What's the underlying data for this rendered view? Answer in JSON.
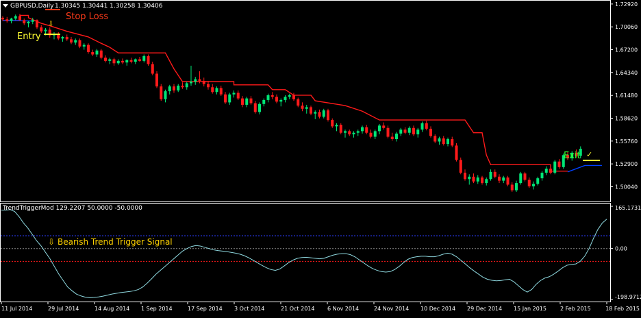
{
  "header": {
    "symbol_label": "GBPUSD,Daily",
    "ohlc": "1.30345 1.30441 1.30258 1.30406"
  },
  "indicator_header": "TrendTriggerMod 129.2207 50.0000 -50.0000",
  "annotations": {
    "stop_loss": "Stop Loss",
    "entry": "Entry",
    "exit": "Exit",
    "bearish_signal": "Bearish Trend Trigger Signal",
    "arrow_glyph": "⇩",
    "check_glyph": "✓"
  },
  "colors": {
    "background": "#000000",
    "border": "#ffffff",
    "bull": "#00e676",
    "bear": "#ff1a1a",
    "stop_line": "#ff1a1a",
    "stop_line_low": "#0040ff",
    "stop_loss_text": "#ff3b1a",
    "entry_text": "#ffff33",
    "exit_text": "#33ff33",
    "signal_text": "#ffd200",
    "oscillator": "#8fd9e0",
    "level_upper": "#2b3cff",
    "level_zero": "#888888",
    "level_lower": "#ff1a1a"
  },
  "chart_data": [
    {
      "type": "candlestick",
      "title": "GBPUSD,Daily",
      "ylim": [
        1.4888,
        1.7308
      ],
      "y_ticks": [
        "1.72920",
        "1.70060",
        "1.67200",
        "1.64340",
        "1.61480",
        "1.58620",
        "1.55760",
        "1.52900",
        "1.50040"
      ],
      "x_ticks": [
        "11 Jul 2014",
        "29 Jul 2014",
        "14 Aug 2014",
        "1 Sep 2014",
        "17 Sep 2014",
        "3 Oct 2014",
        "21 Oct 2014",
        "6 Nov 2014",
        "24 Nov 2014",
        "10 Dec 2014",
        "29 Dec 2014",
        "15 Jan 2015",
        "2 Feb 2015",
        "18 Feb 2015"
      ],
      "candles": [
        [
          1.712,
          1.714,
          1.708,
          1.71
        ],
        [
          1.71,
          1.713,
          1.706,
          1.708
        ],
        [
          1.708,
          1.712,
          1.705,
          1.711
        ],
        [
          1.711,
          1.716,
          1.709,
          1.714
        ],
        [
          1.714,
          1.717,
          1.708,
          1.709
        ],
        [
          1.709,
          1.711,
          1.703,
          1.705
        ],
        [
          1.705,
          1.708,
          1.7,
          1.707
        ],
        [
          1.707,
          1.712,
          1.704,
          1.709
        ],
        [
          1.709,
          1.71,
          1.698,
          1.7
        ],
        [
          1.7,
          1.703,
          1.693,
          1.695
        ],
        [
          1.695,
          1.699,
          1.69,
          1.697
        ],
        [
          1.697,
          1.7,
          1.687,
          1.69
        ],
        [
          1.69,
          1.694,
          1.685,
          1.692
        ],
        [
          1.692,
          1.694,
          1.684,
          1.686
        ],
        [
          1.686,
          1.689,
          1.682,
          1.688
        ],
        [
          1.688,
          1.691,
          1.683,
          1.685
        ],
        [
          1.685,
          1.688,
          1.679,
          1.681
        ],
        [
          1.681,
          1.686,
          1.678,
          1.684
        ],
        [
          1.684,
          1.686,
          1.674,
          1.676
        ],
        [
          1.676,
          1.68,
          1.672,
          1.678
        ],
        [
          1.678,
          1.68,
          1.667,
          1.669
        ],
        [
          1.669,
          1.672,
          1.664,
          1.666
        ],
        [
          1.666,
          1.673,
          1.663,
          1.671
        ],
        [
          1.671,
          1.673,
          1.66,
          1.662
        ],
        [
          1.662,
          1.665,
          1.656,
          1.658
        ],
        [
          1.658,
          1.662,
          1.654,
          1.66
        ],
        [
          1.66,
          1.662,
          1.652,
          1.655
        ],
        [
          1.655,
          1.66,
          1.653,
          1.658
        ],
        [
          1.658,
          1.661,
          1.654,
          1.656
        ],
        [
          1.656,
          1.66,
          1.652,
          1.659
        ],
        [
          1.659,
          1.662,
          1.655,
          1.657
        ],
        [
          1.657,
          1.661,
          1.654,
          1.66
        ],
        [
          1.66,
          1.663,
          1.657,
          1.658
        ],
        [
          1.658,
          1.666,
          1.656,
          1.664
        ],
        [
          1.664,
          1.666,
          1.652,
          1.654
        ],
        [
          1.654,
          1.657,
          1.64,
          1.642
        ],
        [
          1.642,
          1.645,
          1.624,
          1.626
        ],
        [
          1.626,
          1.629,
          1.608,
          1.61
        ],
        [
          1.61,
          1.622,
          1.606,
          1.62
        ],
        [
          1.62,
          1.628,
          1.616,
          1.626
        ],
        [
          1.626,
          1.629,
          1.618,
          1.621
        ],
        [
          1.621,
          1.629,
          1.619,
          1.627
        ],
        [
          1.627,
          1.631,
          1.623,
          1.625
        ],
        [
          1.625,
          1.632,
          1.622,
          1.63
        ],
        [
          1.63,
          1.652,
          1.627,
          1.632
        ],
        [
          1.632,
          1.638,
          1.628,
          1.635
        ],
        [
          1.635,
          1.645,
          1.63,
          1.633
        ],
        [
          1.633,
          1.637,
          1.626,
          1.629
        ],
        [
          1.629,
          1.633,
          1.622,
          1.625
        ],
        [
          1.625,
          1.629,
          1.617,
          1.619
        ],
        [
          1.619,
          1.626,
          1.616,
          1.624
        ],
        [
          1.624,
          1.627,
          1.614,
          1.616
        ],
        [
          1.616,
          1.619,
          1.604,
          1.606
        ],
        [
          1.606,
          1.618,
          1.603,
          1.616
        ],
        [
          1.616,
          1.621,
          1.612,
          1.618
        ],
        [
          1.618,
          1.621,
          1.609,
          1.611
        ],
        [
          1.611,
          1.614,
          1.6,
          1.603
        ],
        [
          1.603,
          1.613,
          1.6,
          1.611
        ],
        [
          1.611,
          1.614,
          1.603,
          1.605
        ],
        [
          1.605,
          1.608,
          1.592,
          1.594
        ],
        [
          1.594,
          1.606,
          1.591,
          1.604
        ],
        [
          1.604,
          1.611,
          1.601,
          1.609
        ],
        [
          1.609,
          1.617,
          1.606,
          1.615
        ],
        [
          1.615,
          1.619,
          1.61,
          1.613
        ],
        [
          1.613,
          1.616,
          1.605,
          1.607
        ],
        [
          1.607,
          1.611,
          1.601,
          1.609
        ],
        [
          1.609,
          1.615,
          1.606,
          1.613
        ],
        [
          1.613,
          1.617,
          1.61,
          1.615
        ],
        [
          1.615,
          1.618,
          1.608,
          1.61
        ],
        [
          1.61,
          1.612,
          1.6,
          1.602
        ],
        [
          1.602,
          1.606,
          1.595,
          1.598
        ],
        [
          1.598,
          1.603,
          1.592,
          1.6
        ],
        [
          1.6,
          1.602,
          1.59,
          1.592
        ],
        [
          1.592,
          1.596,
          1.585,
          1.594
        ],
        [
          1.594,
          1.597,
          1.586,
          1.588
        ],
        [
          1.588,
          1.598,
          1.586,
          1.596
        ],
        [
          1.596,
          1.598,
          1.582,
          1.584
        ],
        [
          1.584,
          1.586,
          1.574,
          1.576
        ],
        [
          1.576,
          1.58,
          1.57,
          1.578
        ],
        [
          1.578,
          1.58,
          1.566,
          1.568
        ],
        [
          1.568,
          1.572,
          1.562,
          1.57
        ],
        [
          1.57,
          1.572,
          1.564,
          1.566
        ],
        [
          1.566,
          1.57,
          1.562,
          1.568
        ],
        [
          1.568,
          1.572,
          1.564,
          1.57
        ],
        [
          1.57,
          1.577,
          1.567,
          1.575
        ],
        [
          1.575,
          1.578,
          1.566,
          1.568
        ],
        [
          1.568,
          1.572,
          1.561,
          1.563
        ],
        [
          1.563,
          1.572,
          1.56,
          1.57
        ],
        [
          1.57,
          1.579,
          1.566,
          1.577
        ],
        [
          1.577,
          1.581,
          1.572,
          1.574
        ],
        [
          1.574,
          1.577,
          1.561,
          1.563
        ],
        [
          1.563,
          1.568,
          1.558,
          1.56
        ],
        [
          1.56,
          1.569,
          1.557,
          1.567
        ],
        [
          1.567,
          1.574,
          1.564,
          1.572
        ],
        [
          1.572,
          1.575,
          1.566,
          1.568
        ],
        [
          1.568,
          1.576,
          1.565,
          1.574
        ],
        [
          1.574,
          1.577,
          1.564,
          1.566
        ],
        [
          1.566,
          1.574,
          1.562,
          1.572
        ],
        [
          1.572,
          1.582,
          1.569,
          1.58
        ],
        [
          1.58,
          1.583,
          1.571,
          1.573
        ],
        [
          1.573,
          1.576,
          1.562,
          1.564
        ],
        [
          1.564,
          1.566,
          1.555,
          1.557
        ],
        [
          1.557,
          1.563,
          1.553,
          1.561
        ],
        [
          1.561,
          1.564,
          1.552,
          1.554
        ],
        [
          1.554,
          1.562,
          1.551,
          1.56
        ],
        [
          1.56,
          1.563,
          1.55,
          1.552
        ],
        [
          1.552,
          1.555,
          1.532,
          1.534
        ],
        [
          1.534,
          1.537,
          1.516,
          1.518
        ],
        [
          1.518,
          1.522,
          1.508,
          1.51
        ],
        [
          1.51,
          1.516,
          1.503,
          1.513
        ],
        [
          1.513,
          1.517,
          1.505,
          1.507
        ],
        [
          1.507,
          1.515,
          1.504,
          1.512
        ],
        [
          1.512,
          1.514,
          1.503,
          1.505
        ],
        [
          1.505,
          1.512,
          1.502,
          1.51
        ],
        [
          1.51,
          1.522,
          1.508,
          1.519
        ],
        [
          1.519,
          1.522,
          1.511,
          1.513
        ],
        [
          1.513,
          1.516,
          1.505,
          1.508
        ],
        [
          1.508,
          1.514,
          1.505,
          1.512
        ],
        [
          1.512,
          1.514,
          1.501,
          1.503
        ],
        [
          1.503,
          1.506,
          1.494,
          1.496
        ],
        [
          1.496,
          1.508,
          1.494,
          1.505
        ],
        [
          1.505,
          1.519,
          1.503,
          1.517
        ],
        [
          1.517,
          1.519,
          1.507,
          1.509
        ],
        [
          1.509,
          1.512,
          1.499,
          1.501
        ],
        [
          1.501,
          1.507,
          1.497,
          1.504
        ],
        [
          1.504,
          1.513,
          1.502,
          1.511
        ],
        [
          1.511,
          1.52,
          1.508,
          1.518
        ],
        [
          1.518,
          1.526,
          1.515,
          1.523
        ],
        [
          1.523,
          1.526,
          1.516,
          1.518
        ],
        [
          1.518,
          1.534,
          1.516,
          1.532
        ],
        [
          1.532,
          1.535,
          1.523,
          1.525
        ],
        [
          1.525,
          1.542,
          1.523,
          1.54
        ],
        [
          1.54,
          1.544,
          1.534,
          1.536
        ],
        [
          1.536,
          1.545,
          1.533,
          1.543
        ],
        [
          1.543,
          1.547,
          1.537,
          1.539
        ],
        [
          1.539,
          1.551,
          1.536,
          1.548
        ]
      ],
      "stop_line": [
        [
          0,
          1.7085
        ],
        [
          4,
          1.7085
        ],
        [
          4,
          1.715
        ],
        [
          6,
          1.715
        ],
        [
          6,
          1.712
        ],
        [
          9,
          1.705
        ],
        [
          11,
          1.702
        ],
        [
          15,
          1.695
        ],
        [
          20,
          1.688
        ],
        [
          23,
          1.68
        ],
        [
          25,
          1.675
        ],
        [
          27,
          1.668
        ],
        [
          38,
          1.668
        ],
        [
          40,
          1.648
        ],
        [
          42,
          1.632
        ],
        [
          54,
          1.632
        ],
        [
          54,
          1.628
        ],
        [
          62,
          1.628
        ],
        [
          63,
          1.622
        ],
        [
          66,
          1.622
        ],
        [
          68,
          1.615
        ],
        [
          72,
          1.615
        ],
        [
          73,
          1.608
        ],
        [
          80,
          1.602
        ],
        [
          84,
          1.595
        ],
        [
          88,
          1.584
        ],
        [
          108,
          1.584
        ],
        [
          110,
          1.568
        ],
        [
          112,
          1.568
        ],
        [
          113,
          1.54
        ],
        [
          114,
          1.528
        ],
        [
          128,
          1.528
        ],
        [
          128,
          1.52
        ],
        [
          132,
          1.52
        ]
      ],
      "stop_line_low": [
        [
          0,
          1.7085
        ],
        [
          7,
          1.708
        ]
      ],
      "stop_line_low_end": [
        [
          132,
          1.519
        ],
        [
          136,
          1.527
        ],
        [
          140,
          1.527
        ]
      ]
    },
    {
      "type": "line",
      "title": "TrendTriggerMod 129.2207 50.0000 -50.0000",
      "ylim": [
        -198.9712,
        165.1731
      ],
      "y_ticks": [
        "165.1731",
        "0.00",
        "-198.9712"
      ],
      "levels": [
        50,
        0,
        -50
      ],
      "values": [
        150,
        150,
        152,
        145,
        125,
        100,
        80,
        55,
        30,
        10,
        -15,
        -40,
        -70,
        -100,
        -125,
        -150,
        -165,
        -178,
        -185,
        -190,
        -192,
        -191,
        -189,
        -186,
        -182,
        -178,
        -175,
        -172,
        -170,
        -168,
        -165,
        -160,
        -150,
        -135,
        -118,
        -100,
        -85,
        -70,
        -55,
        -40,
        -25,
        -10,
        0,
        8,
        12,
        10,
        5,
        0,
        -5,
        -8,
        -10,
        -12,
        -15,
        -18,
        -22,
        -28,
        -36,
        -46,
        -56,
        -66,
        -75,
        -82,
        -85,
        -80,
        -68,
        -55,
        -45,
        -38,
        -35,
        -34,
        -36,
        -38,
        -40,
        -38,
        -32,
        -26,
        -22,
        -20,
        -20,
        -24,
        -32,
        -44,
        -56,
        -68,
        -78,
        -85,
        -90,
        -92,
        -90,
        -82,
        -70,
        -55,
        -42,
        -35,
        -32,
        -30,
        -30,
        -32,
        -32,
        -28,
        -22,
        -18,
        -22,
        -32,
        -46,
        -60,
        -75,
        -88,
        -100,
        -112,
        -120,
        -124,
        -126,
        -125,
        -122,
        -120,
        -130,
        -145,
        -160,
        -170,
        -160,
        -140,
        -125,
        -115,
        -110,
        -100,
        -88,
        -75,
        -65,
        -62,
        -60,
        -50,
        -30,
        0,
        40,
        75,
        100,
        115
      ]
    }
  ]
}
